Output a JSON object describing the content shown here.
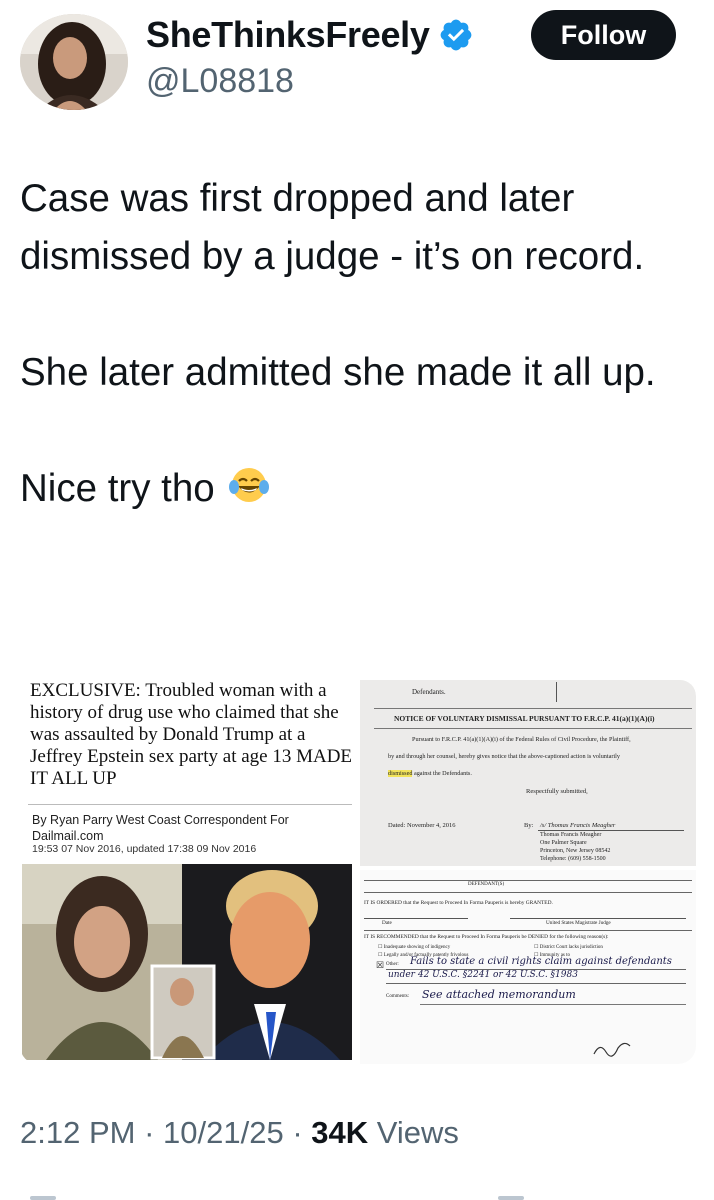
{
  "user": {
    "display_name": "SheThinksFreely",
    "handle": "@L08818",
    "verified_icon": "verified-badge-icon",
    "follow_label": "Follow"
  },
  "tweet": {
    "paragraphs": [
      "Case was first dropped and later dismissed by a judge - it’s on record.",
      "She later admitted she made it all up.",
      "Nice try tho"
    ],
    "emoji": "face-with-tears-of-joy-icon"
  },
  "media": {
    "article": {
      "headline": "EXCLUSIVE: Troubled woman with a history of drug use who claimed that she was assaulted by Donald Trump at a Jeffrey Epstein sex party at age 13 MADE IT ALL UP",
      "byline": "By Ryan Parry West Coast Correspondent For Dailmail.com",
      "date": "19:53 07 Nov 2016, updated 17:38 09 Nov 2016"
    },
    "doc_notice": {
      "defendants": "Defendants.",
      "title": "NOTICE OF VOLUNTARY DISMISSAL PURSUANT TO F.R.C.P. 41(a)(1)(A)(i)",
      "body_line1": "Pursuant to F.R.C.P. 41(a)(1)(A)(i) of the Federal Rules of Civil Procedure, the Plaintiff,",
      "body_line2": "by and through her counsel, hereby gives notice that the above-captioned action is voluntarily",
      "highlight": "dismissed",
      "body_line3": "against the Defendants.",
      "signoff": "Respectfully submitted,",
      "dated": "Dated: November 4, 2016",
      "by": "By:",
      "signature": "/s/ Thomas Francis Meagher",
      "counsel_lines": [
        "Thomas Francis Meagher",
        "One Palmer Square",
        "Princeton, New Jersey 08542",
        "Telephone: (609) 558-1500"
      ]
    },
    "doc_order": {
      "defendant_label": "DEFENDANT(S)",
      "ordered": "IT IS ORDERED that the Request to Proceed In Forma Pauperis is hereby GRANTED.",
      "date_label": "Date",
      "judge_label": "United States Magistrate Judge",
      "recommended": "IT IS RECOMMENDED that the Request to Proceed In Forma Pauperis be DENIED for the following reason(s):",
      "options_left": [
        "Inadequate showing of indigency",
        "Legally and/or factually patently frivolous"
      ],
      "options_right": [
        "District Court lacks jurisdiction",
        "Immunity as to"
      ],
      "other_label": "Other:",
      "other_handwriting_1": "Fails to state a civil rights claim against defendants",
      "other_handwriting_2": "under 42 U.S.C. §2241 or 42 U.S.C. §1983",
      "comments_label": "Comments:",
      "comments_handwriting": "See attached memorandum"
    }
  },
  "meta": {
    "time": "2:12 PM",
    "separator": "·",
    "date": "10/21/25",
    "views_count": "34K",
    "views_label": "Views"
  },
  "colors": {
    "text": "#0f1419",
    "secondary": "#536471",
    "verified": "#1d9bf0",
    "highlight": "#f2e35a"
  }
}
